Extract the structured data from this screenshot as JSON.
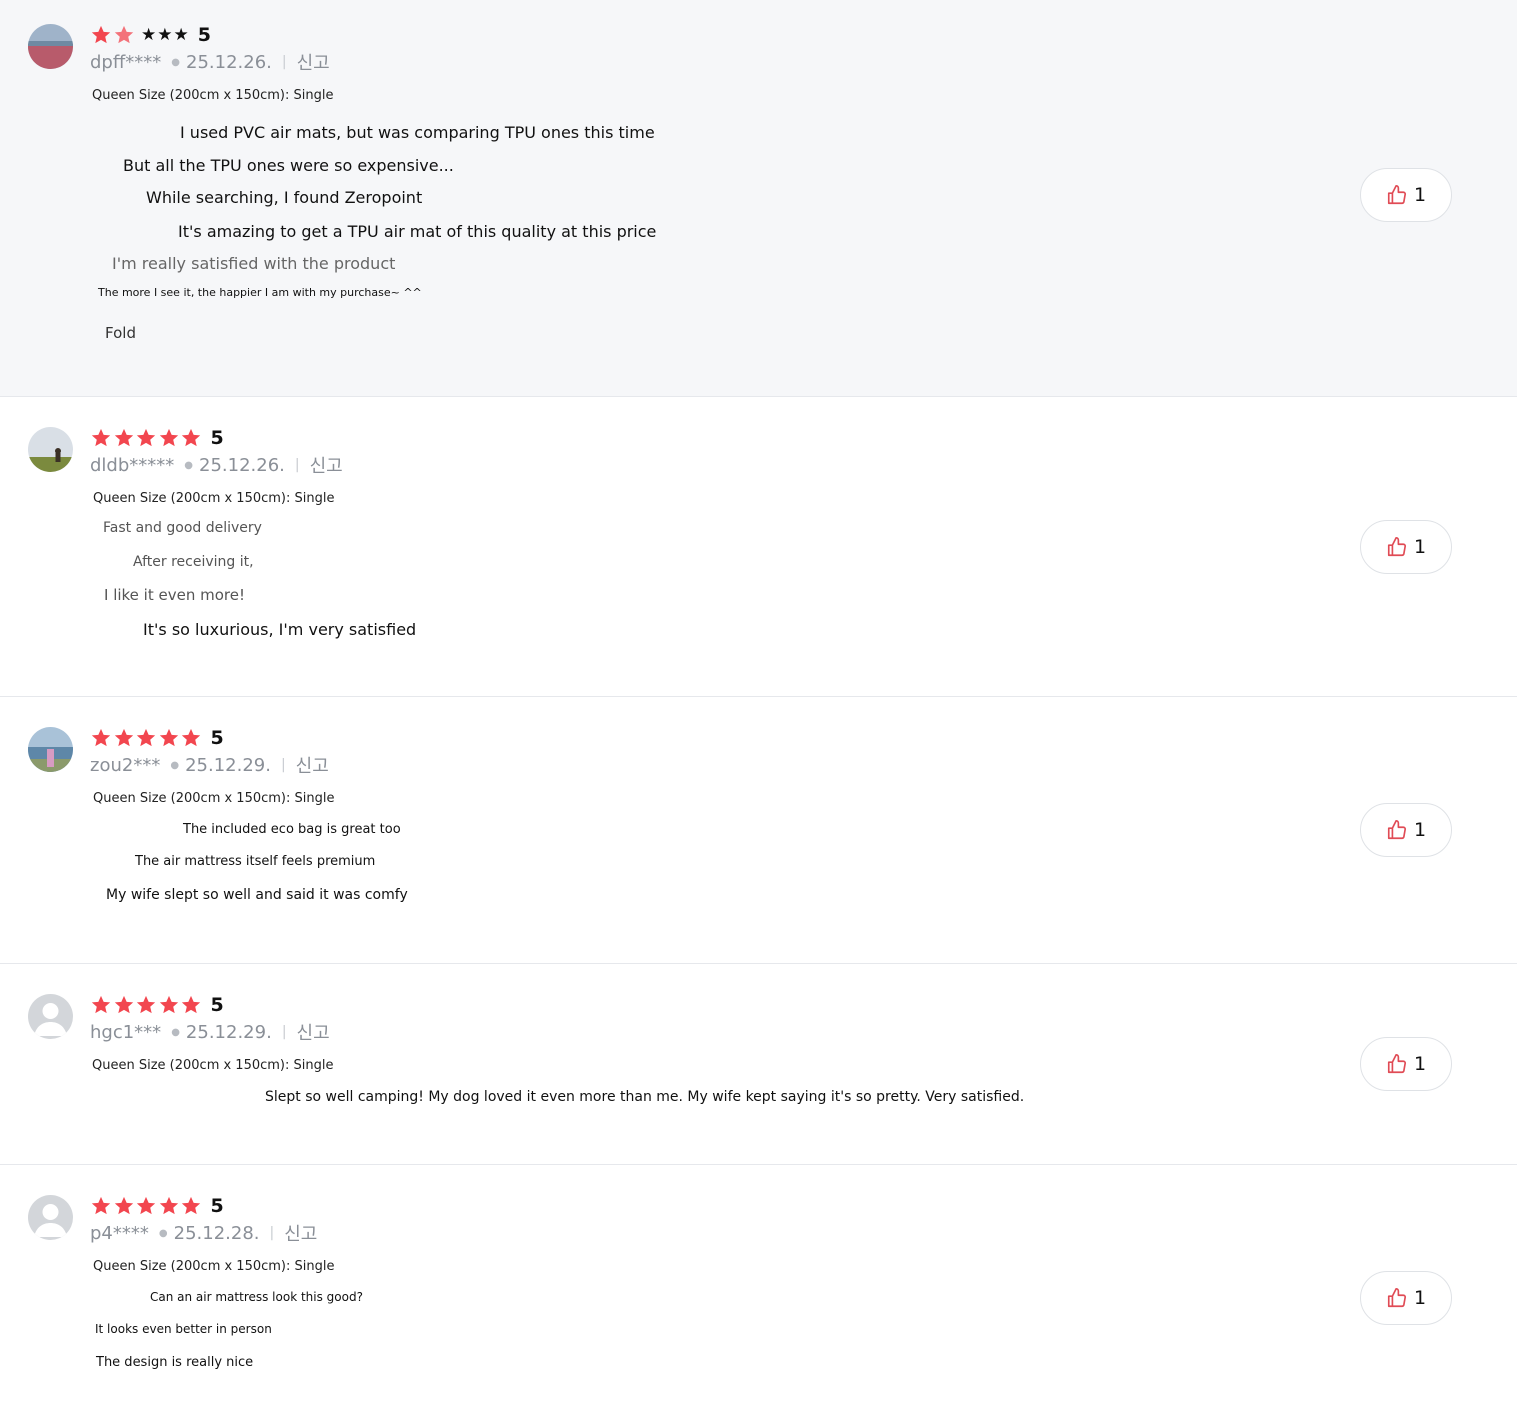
{
  "theme": {
    "star_color": "#f2464f",
    "like_icon_color": "#e04b55"
  },
  "reviews": [
    {
      "user": "dpff****",
      "date": "25.12.26.",
      "report": "신고",
      "score": "5",
      "stars_text": "★★★",
      "option": "Queen Size (200cm x 150cm): Single",
      "lines": [
        "I used PVC air mats, but was comparing TPU ones this time",
        "But all the TPU ones were so expensive...",
        "While searching, I found Zeropoint",
        "It's amazing to get a TPU air mat of this quality at this price",
        "I'm really satisfied with the product",
        "The more I see it, the happier I am with my purchase~ ^^"
      ],
      "fold": "Fold",
      "likes": "1"
    },
    {
      "user": "dldb*****",
      "date": "25.12.26.",
      "report": "신고",
      "score": "5",
      "option": "Queen Size (200cm x 150cm): Single",
      "lines": [
        "Fast and good delivery",
        "After receiving it,",
        "I like it even more!",
        "It's so luxurious, I'm very satisfied"
      ],
      "likes": "1"
    },
    {
      "user": "zou2***",
      "date": "25.12.29.",
      "report": "신고",
      "score": "5",
      "option": "Queen Size (200cm x 150cm): Single",
      "lines": [
        "The included eco bag is great too",
        "The air mattress itself feels premium",
        "My wife slept so well and said it was comfy"
      ],
      "likes": "1"
    },
    {
      "user": "hgc1***",
      "date": "25.12.29.",
      "report": "신고",
      "score": "5",
      "option": "Queen Size (200cm x 150cm): Single",
      "lines": [
        "Slept so well camping! My dog loved it even more than me. My wife kept saying it's so pretty. Very satisfied."
      ],
      "likes": "1"
    },
    {
      "user": "p4****",
      "date": "25.12.28.",
      "report": "신고",
      "score": "5",
      "option": "Queen Size (200cm x 150cm): Single",
      "lines": [
        "Can an air mattress look this good?",
        "It looks even better in person",
        "The design is really nice"
      ],
      "likes": "1"
    }
  ]
}
